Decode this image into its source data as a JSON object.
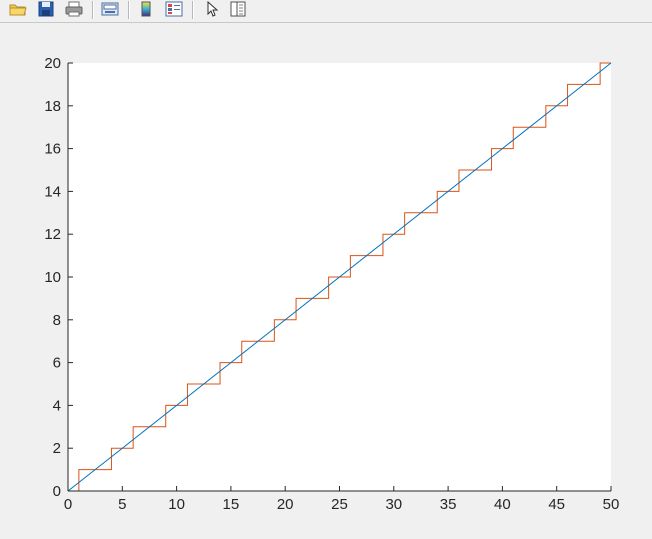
{
  "toolbar": {
    "items": [
      {
        "icon": "open-folder-icon"
      },
      {
        "icon": "save-icon"
      },
      {
        "icon": "print-icon"
      },
      {
        "separator": true
      },
      {
        "icon": "link-plot-icon"
      },
      {
        "separator": true
      },
      {
        "icon": "insert-colorbar-icon"
      },
      {
        "icon": "insert-legend-icon"
      },
      {
        "separator": true
      },
      {
        "icon": "edit-plot-arrow-icon"
      },
      {
        "icon": "property-inspector-icon"
      }
    ]
  },
  "colors": {
    "figure_bg": "#f0f0f0",
    "axes_bg": "#ffffff",
    "line_series": "#0072bd",
    "stair_series": "#d95319",
    "axis": "#262626"
  },
  "chart_data": {
    "type": "line",
    "title": "",
    "xlabel": "",
    "ylabel": "",
    "xlim": [
      0,
      50
    ],
    "ylim": [
      0,
      20
    ],
    "xticks": [
      "0",
      "5",
      "10",
      "15",
      "20",
      "25",
      "30",
      "35",
      "40",
      "45",
      "50"
    ],
    "yticks": [
      "0",
      "2",
      "4",
      "6",
      "8",
      "10",
      "12",
      "14",
      "16",
      "18",
      "20"
    ],
    "grid": false,
    "legend": "none",
    "series": [
      {
        "style": "line",
        "x": [
          0,
          50
        ],
        "y": [
          0,
          20
        ]
      },
      {
        "style": "stairs",
        "x": [
          0,
          1,
          4,
          6,
          9,
          11,
          14,
          16,
          19,
          21,
          24,
          26,
          29,
          31,
          34,
          36,
          39,
          41,
          44,
          46,
          49,
          50
        ],
        "y": [
          0,
          1,
          2,
          3,
          4,
          5,
          6,
          7,
          8,
          9,
          10,
          11,
          12,
          13,
          14,
          15,
          16,
          17,
          18,
          19,
          20,
          20
        ]
      }
    ]
  }
}
